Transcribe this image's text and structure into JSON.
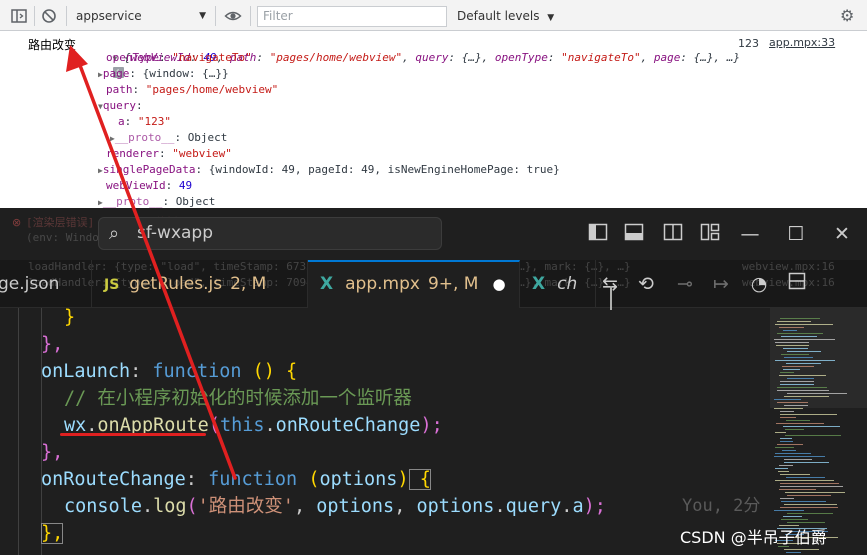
{
  "devtools": {
    "context": "appservice",
    "filter_placeholder": "Filter",
    "levels": "Default levels",
    "log": {
      "message": "路由改变",
      "summary": {
        "open": "{",
        "webViewId_key": "webViewId",
        "webViewId_val": "49",
        "path_key": "path",
        "path_val": "\"pages/home/webview\"",
        "query_key": "query",
        "query_val": "{…}",
        "openType_key": "openType",
        "openType_val": "\"navigateTo\"",
        "page_key": "page",
        "page_val": "{…}",
        "ellipsis": "…}"
      },
      "info_badge": "i",
      "count": "123",
      "source": "app.mpx:33",
      "lines": [
        {
          "key": "openType",
          "value": "\"navigateTo\""
        },
        {
          "key": "page",
          "value": "{window: {…}}"
        },
        {
          "key": "path",
          "value": "\"pages/home/webview\""
        },
        {
          "key": "query",
          "value": ""
        },
        {
          "key": "a",
          "value": "\"123\""
        },
        {
          "key": "__proto__",
          "value": "Object"
        },
        {
          "key": "renderer",
          "value": "\"webview\""
        },
        {
          "key": "singlePageData",
          "value": "{windowId: 49, pageId: 49, isNewEngineHomePage: true}"
        },
        {
          "key": "webViewId",
          "value": "49"
        },
        {
          "key": "__proto__",
          "value": "Object"
        }
      ]
    },
    "bg_lines": [
      "[渲染层错误] 一个页面只能插入一个 <web-view />",
      "(env: Windows,mp,1.06.2307260; lib: 2.18.4)",
      "loadHandler: {type: \"load\", timeStamp: 6733, target: {…}, currentTarget: {…}, mark: {…}, …}",
      "loadHandler: {type: \"load\", timeStamp: 7094, target: {…}, currentTarget: {…}, mark: {…}, …}"
    ],
    "bg_sources": [
      "webview.mpx:16",
      "webview.mpx:16"
    ]
  },
  "vscode": {
    "search": "sf-wxapp",
    "tabs": [
      {
        "label": "ge.json",
        "status": ""
      },
      {
        "label": "getRules.js",
        "status": "2, M",
        "icon": "JS"
      },
      {
        "label": "app.mpx",
        "status": "9+, M",
        "icon": "X",
        "dirty": "●"
      },
      {
        "label": "ch",
        "status": "",
        "icon": "X"
      }
    ],
    "code": {
      "l0_close": "}",
      "l1": "},",
      "l2_key": "onLaunch",
      "l2_colon": ": ",
      "l2_kw": "function",
      "l2_parens": " ()",
      "l2_brace": " {",
      "l3_comment": "// 在小程序初始化的时候添加一个监听器",
      "l4_obj": "wx",
      "l4_fn": "onAppRoute",
      "l4_open": "(",
      "l4_this": "this",
      "l4_arg": "onRouteChange",
      "l4_close": ");",
      "l5": "},",
      "l6_key": "onRouteChange",
      "l6_kw": "function",
      "l6_param": "options",
      "l7_obj": "console",
      "l7_fn": "log",
      "l7_str": "'路由改变'",
      "l7_a1": "options",
      "l7_a2": "options",
      "l7_a2b": "query",
      "l7_a2c": "a",
      "l7_end": ");",
      "l8": "},"
    },
    "blame": "You, 2分"
  },
  "watermark": "CSDN @半吊子伯爵",
  "colors": {
    "annotation": "#e02020",
    "vscode_bg": "#1f1f1f",
    "devtools_bg": "#ffffff"
  }
}
